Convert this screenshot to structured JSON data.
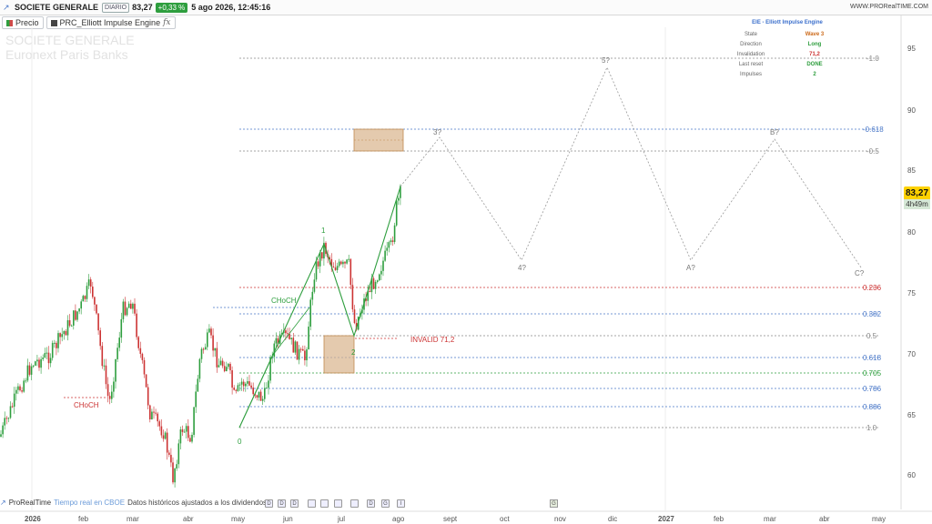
{
  "header": {
    "instrument": "SOCIETE GENERALE",
    "period": "DIARIO",
    "price": "83,27",
    "change": "+0,33 %",
    "datetime": "5 ago 2026, 12:45:16",
    "url": "WWW.PRORealTIME.COM"
  },
  "tabs": [
    {
      "label": "Precio",
      "color": "#d04a4a"
    },
    {
      "label": "PRC_Elliott Impulse Engine",
      "fx": "fx",
      "color": "#444444"
    }
  ],
  "watermark": {
    "line1": "SOCIETE GENERALE",
    "line2": "Euronext Paris  Banks"
  },
  "badge": {
    "price": "83,27",
    "countdown": "4h49m",
    "color": "#ffd200"
  },
  "eie_panel": {
    "title": "EIE - Elliott Impulse Engine",
    "rows": [
      {
        "key": "State",
        "value": "Wave 3",
        "color": "#cc6a1a"
      },
      {
        "key": "Direction",
        "value": "Long",
        "color": "#2e9e3e"
      },
      {
        "key": "Invalidation",
        "value": "71,2",
        "color": "#cc3333"
      },
      {
        "key": "Last reset",
        "value": "DONE",
        "color": "#2e9e3e"
      },
      {
        "key": "Impulses",
        "value": "2",
        "color": "#2e9e3e"
      }
    ]
  },
  "price_axis": {
    "ticks": [
      "95",
      "90",
      "85",
      "80",
      "75",
      "70",
      "65",
      "60"
    ]
  },
  "time_axis": {
    "ticks": [
      "2026",
      "feb",
      "mar",
      "abr",
      "may",
      "jun",
      "jul",
      "ago",
      "sept",
      "oct",
      "nov",
      "dic",
      "2027",
      "feb",
      "mar",
      "abr",
      "may"
    ]
  },
  "fib_levels": [
    {
      "label": "-1.0",
      "color": "#888888"
    },
    {
      "label": "-0.618",
      "color": "#4a78c8"
    },
    {
      "label": "-0.5",
      "color": "#888888"
    },
    {
      "label": "0.236",
      "color": "#cc3333"
    },
    {
      "label": "0.382",
      "color": "#4a78c8"
    },
    {
      "label": "0.5",
      "color": "#888888"
    },
    {
      "label": "0.618",
      "color": "#4a78c8"
    },
    {
      "label": "0.705",
      "color": "#2e9e3e"
    },
    {
      "label": "0.786",
      "color": "#4a78c8"
    },
    {
      "label": "0.886",
      "color": "#4a78c8"
    },
    {
      "label": "1.0",
      "color": "#888888"
    }
  ],
  "annotations": {
    "choch_left": "CHoCH",
    "choch_mid": "CHoCH",
    "invalid": "INVALID 71,2",
    "wave0": "0",
    "wave1": "1",
    "wave2": "2",
    "proj3": "3?",
    "proj4": "4?",
    "proj5": "5?",
    "projA": "A?",
    "projB": "B?",
    "projC": "C?"
  },
  "footer": {
    "brand": "ProRealTime",
    "realtime": "Tiempo real en CBOE",
    "adjusted": "Datos históricos ajustados a los dividendos"
  }
}
